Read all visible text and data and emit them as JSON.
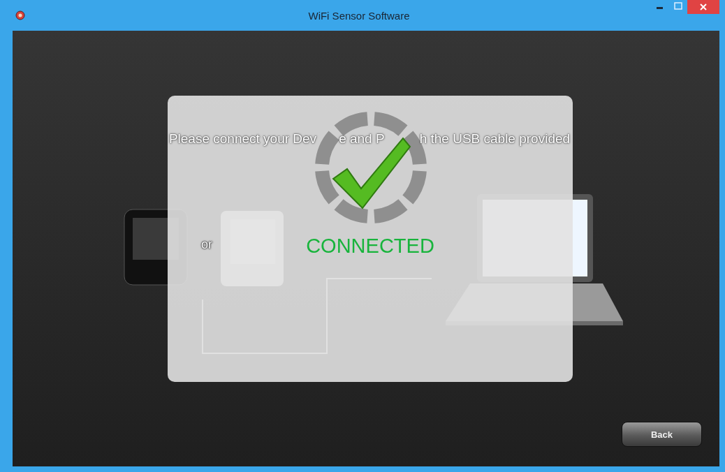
{
  "window": {
    "title": "WiFi Sensor Software"
  },
  "instruction_parts": [
    "Please connect your Dev",
    "e and P",
    "h the USB cable provided"
  ],
  "or_label": "or",
  "status": {
    "connected": true,
    "label": "CONNECTED"
  },
  "buttons": [
    {
      "label": "Back"
    }
  ]
}
